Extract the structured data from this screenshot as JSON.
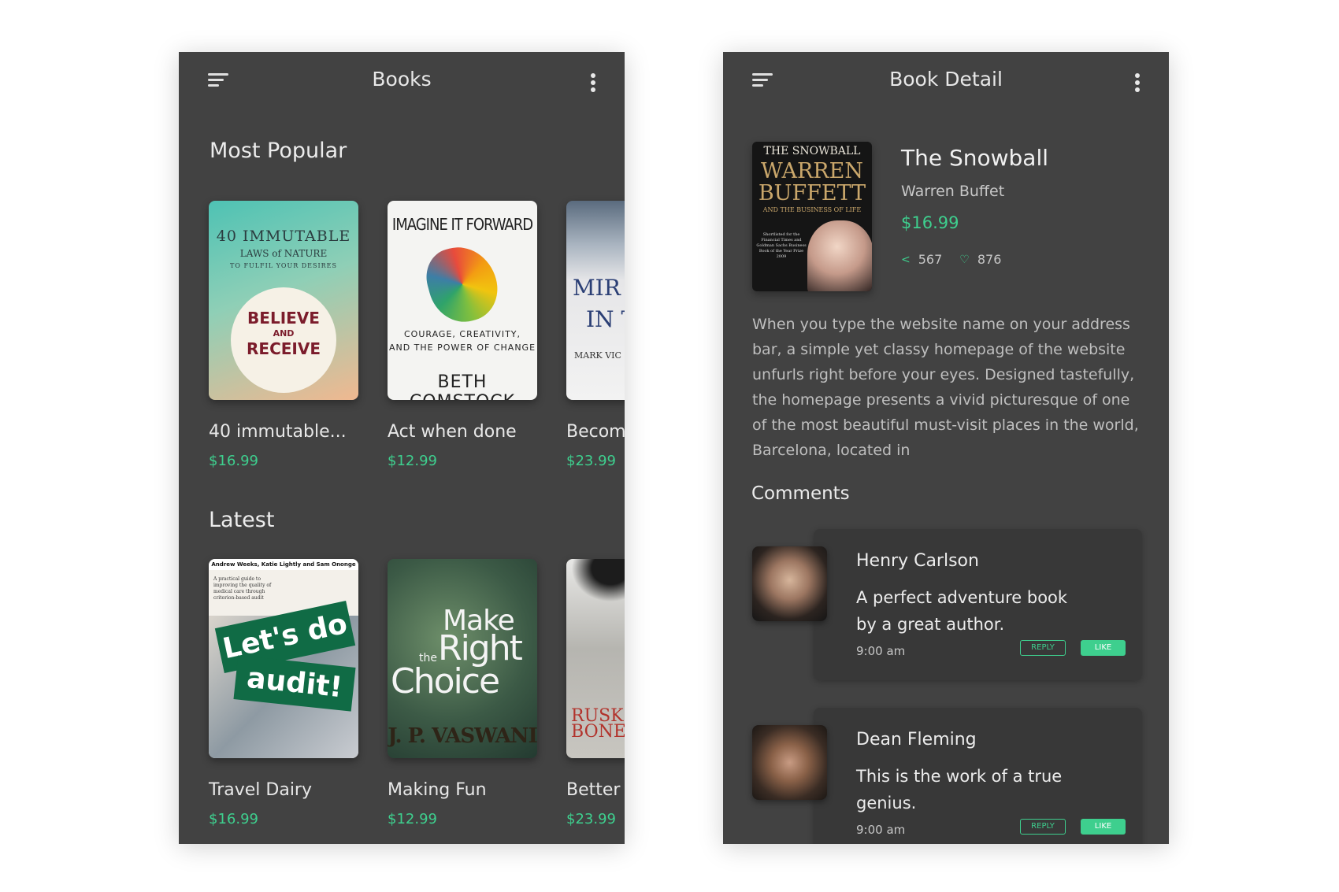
{
  "books_screen": {
    "title": "Books",
    "most_popular": {
      "heading": "Most Popular",
      "items": [
        {
          "name": "40 immutable...",
          "price": "$16.99",
          "cover": {
            "line1": "40 IMMUTABLE",
            "line2": "LAWS of NATURE",
            "line3": "TO FULFIL YOUR DESIRES",
            "line4": "BELIEVE",
            "line5": "AND",
            "line6": "RECEIVE"
          }
        },
        {
          "name": "Act when done",
          "price": "$12.99",
          "cover": {
            "line1": "IMAGINE IT FORWARD",
            "line2": "COURAGE, CREATIVITY,",
            "line3": "AND THE POWER OF CHANGE",
            "line4": "BETH COMSTOCK"
          }
        },
        {
          "name": "Becom",
          "price": "$23.99",
          "cover": {
            "line1": "MIR",
            "line2": "IN T",
            "line3": "MARK VIC"
          }
        }
      ]
    },
    "latest": {
      "heading": "Latest",
      "items": [
        {
          "name": "Travel Dairy",
          "price": "$16.99",
          "cover": {
            "line1": "Andrew Weeks, Katie Lightly and Sam Ononge",
            "line2": "A practical guide to improving the quality of medical care through criterion-based audit",
            "line3": "Let's do",
            "line4": "audit!"
          }
        },
        {
          "name": "Making Fun",
          "price": "$12.99",
          "cover": {
            "line1": "Make",
            "line2": "the",
            "line3": "Right",
            "line4": "Choice",
            "line5": "J. P. VASWANI"
          }
        },
        {
          "name": "Better",
          "price": "$23.99",
          "cover": {
            "line1": "RUSK",
            "line2": "BONE"
          }
        }
      ]
    }
  },
  "detail_screen": {
    "title": "Book Detail",
    "book": {
      "title": "The Snowball",
      "author": "Warren Buffet",
      "price": "$16.99",
      "shares": "567",
      "likes": "876",
      "cover": {
        "line1": "THE SNOWBALL",
        "line2": "WARREN",
        "line3": "BUFFETT",
        "line4": "AND THE BUSINESS OF LIFE",
        "line5": "Shortlisted for the Financial Times and Goldman Sachs Business Book of the Year Prize 2009"
      },
      "description": "When you type the website name on your address bar, a simple yet classy homepage of the website unfurls right before your eyes. Designed tastefully, the homepage presents a vivid picturesque of one of the most beautiful must-visit places in the world, Barcelona, located in"
    },
    "comments_heading": "Comments",
    "comments": [
      {
        "author": "Henry Carlson",
        "text": "A perfect adventure book by a great author.",
        "time": "9:00 am",
        "reply_label": "REPLY",
        "like_label": "LIKE"
      },
      {
        "author": "Dean Fleming",
        "text": "This is the work of a true genius.",
        "time": "9:00 am",
        "reply_label": "REPLY",
        "like_label": "LIKE"
      }
    ]
  },
  "colors": {
    "background": "#424242",
    "accent": "#3ecf8e",
    "card": "#383838"
  }
}
